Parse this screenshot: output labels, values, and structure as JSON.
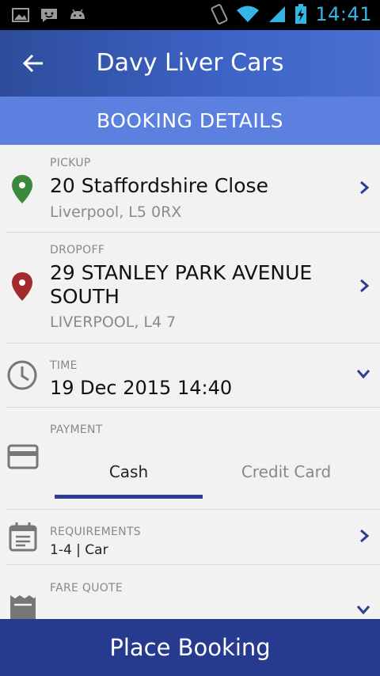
{
  "status_bar": {
    "time": "14:41"
  },
  "app_bar": {
    "title": "Davy Liver Cars"
  },
  "section_header": "BOOKING DETAILS",
  "pickup": {
    "label": "PICKUP",
    "address": "20 Staffordshire Close",
    "city": "Liverpool, L5 0RX"
  },
  "dropoff": {
    "label": "DROPOFF",
    "address_line1": "29 STANLEY PARK AVENUE",
    "address_line2": "SOUTH",
    "city": "LIVERPOOL, L4 7"
  },
  "time": {
    "label": "TIME",
    "value": "19 Dec 2015 14:40"
  },
  "payment": {
    "label": "PAYMENT",
    "tabs": [
      "Cash",
      "Credit Card"
    ],
    "selected": "Cash"
  },
  "requirements": {
    "label": "REQUIREMENTS",
    "value": "1-4 | Car"
  },
  "fare_quote": {
    "label": "FARE QUOTE"
  },
  "action": {
    "label": "Place Booking"
  },
  "colors": {
    "appbar": "#3e63c7",
    "subhead": "#5b80e0",
    "cta": "#263b8f",
    "pickup_pin": "#3a8a3a",
    "dropoff_pin": "#a32a2a",
    "tab_underline": "#2b3e91"
  }
}
